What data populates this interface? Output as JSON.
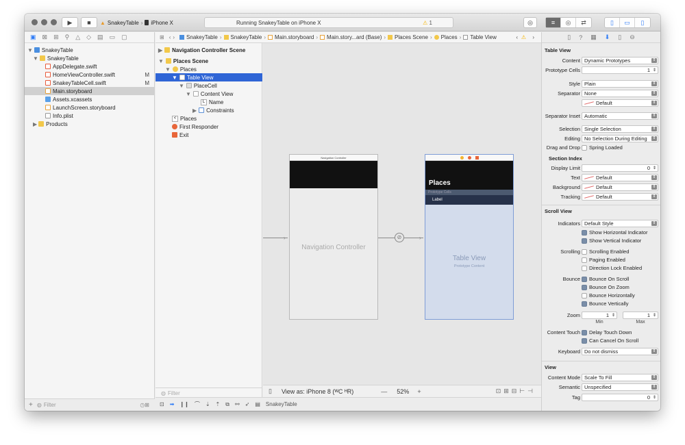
{
  "toolbar": {
    "scheme_app": "SnakeyTable",
    "scheme_device": "iPhone X",
    "activity_text": "Running SnakeyTable on iPhone X",
    "warning_count": "1"
  },
  "navigator": {
    "items": [
      {
        "label": "SnakeyTable",
        "badge": ""
      },
      {
        "label": "SnakeyTable",
        "badge": ""
      },
      {
        "label": "AppDelegate.swift",
        "badge": ""
      },
      {
        "label": "HomeViewController.swift",
        "badge": "M"
      },
      {
        "label": "SnakeyTableCell.swift",
        "badge": "M"
      },
      {
        "label": "Main.storyboard",
        "badge": ""
      },
      {
        "label": "Assets.xcassets",
        "badge": ""
      },
      {
        "label": "LaunchScreen.storyboard",
        "badge": ""
      },
      {
        "label": "Info.plist",
        "badge": ""
      },
      {
        "label": "Products",
        "badge": ""
      }
    ],
    "filter_placeholder": "Filter"
  },
  "jumpbar": [
    "SnakeyTable",
    "SnakeyTable",
    "Main.storyboard",
    "Main.story...ard (Base)",
    "Places Scene",
    "Places",
    "Table View"
  ],
  "outline": {
    "items": [
      "Navigation Controller Scene",
      "Places Scene",
      "Places",
      "Table View",
      "PlaceCell",
      "Content View",
      "Name",
      "Constraints",
      "Places",
      "First Responder",
      "Exit"
    ],
    "filter_placeholder": "Filter"
  },
  "canvas": {
    "nav_controller_title": "Navigation Controller",
    "nav_controller_label": "Navigation Controller",
    "places_title": "Places",
    "prototype_cells": "Prototype Cells",
    "cell_label": "Label",
    "table_view_label": "Table View",
    "prototype_content": "Prototype Content",
    "view_as": "View as: iPhone 8 (ᵂC ᴴR)",
    "zoom": "52%",
    "minus": "—",
    "plus": "+"
  },
  "bottombar": {
    "target": "SnakeyTable"
  },
  "inspector": {
    "table_view_header": "Table View",
    "content_label": "Content",
    "content_value": "Dynamic Prototypes",
    "prototype_cells_label": "Prototype Cells",
    "prototype_cells_value": "1",
    "style_label": "Style",
    "style_value": "Plain",
    "separator_label": "Separator",
    "separator_value": "None",
    "separator_color": "Default",
    "separator_inset_label": "Separator Inset",
    "separator_inset_value": "Automatic",
    "selection_label": "Selection",
    "selection_value": "Single Selection",
    "editing_label": "Editing",
    "editing_value": "No Selection During Editing",
    "drag_drop_label": "Drag and Drop",
    "spring_loaded": "Spring Loaded",
    "section_index_header": "Section Index",
    "display_limit_label": "Display Limit",
    "display_limit_value": "0",
    "text_label": "Text",
    "text_value": "Default",
    "background_label": "Background",
    "background_value": "Default",
    "tracking_label": "Tracking",
    "tracking_value": "Default",
    "scroll_view_header": "Scroll View",
    "indicators_label": "Indicators",
    "indicators_value": "Default Style",
    "show_h": "Show Horizontal Indicator",
    "show_v": "Show Vertical Indicator",
    "scrolling_label": "Scrolling",
    "scrolling_enabled": "Scrolling Enabled",
    "paging_enabled": "Paging Enabled",
    "direction_lock": "Direction Lock Enabled",
    "bounce_label": "Bounce",
    "bounce_on_scroll": "Bounce On Scroll",
    "bounce_on_zoom": "Bounce On Zoom",
    "bounce_h": "Bounce Horizontally",
    "bounce_v": "Bounce Vertically",
    "zoom_label": "Zoom",
    "zoom_min": "1",
    "zoom_max": "1",
    "min_label": "Min",
    "max_label": "Max",
    "content_touch_label": "Content Touch",
    "delay_touch": "Delay Touch Down",
    "cancel_touch": "Can Cancel On Scroll",
    "keyboard_label": "Keyboard",
    "keyboard_value": "Do not dismiss",
    "view_header": "View",
    "content_mode_label": "Content Mode",
    "content_mode_value": "Scale To Fill",
    "semantic_label": "Semantic",
    "semantic_value": "Unspecified",
    "tag_label": "Tag",
    "tag_value": "0"
  },
  "colors": {
    "accent": "#2f65d6",
    "warning": "#f5b400",
    "nav_bar": "#111111",
    "table_blue": "#d3dcec"
  }
}
